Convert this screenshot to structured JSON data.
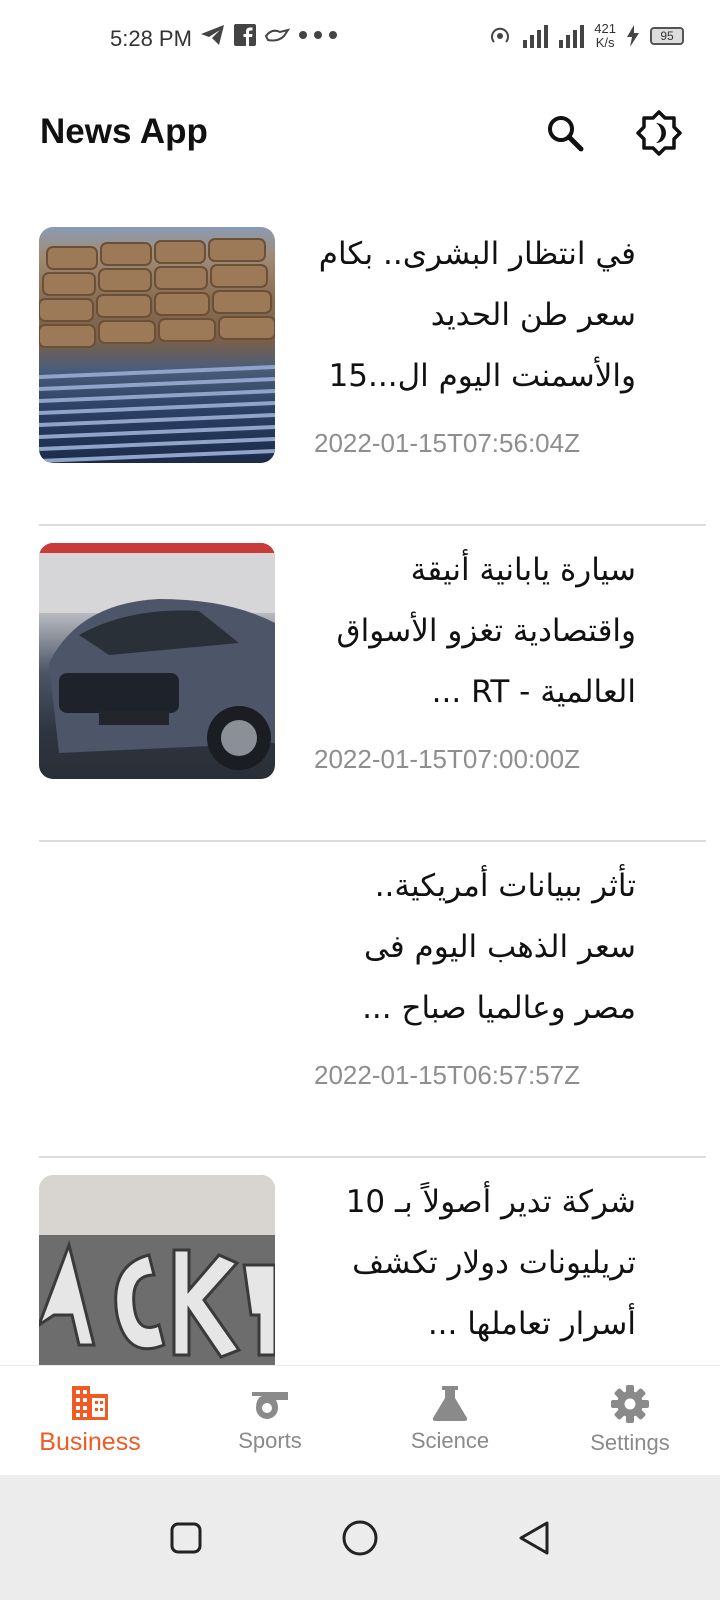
{
  "status_bar": {
    "time": "5:28 PM",
    "speed_value": "421",
    "speed_unit": "K/s",
    "battery": "95"
  },
  "app_bar": {
    "title": "News App",
    "icons": [
      "search-icon",
      "brightness-icon"
    ]
  },
  "articles": [
    {
      "title": "في انتظار البشرى.. بكام سعر طن الحديد والأسمنت اليوم ال...15",
      "date": "2022-01-15T07:56:04Z",
      "has_image": true
    },
    {
      "title": "سيارة يابانية أنيقة واقتصادية تغزو الأسواق العالمية - RT ...",
      "date": "2022-01-15T07:00:00Z",
      "has_image": true
    },
    {
      "title": "تأثر ببيانات أمريكية.. سعر الذهب اليوم فى مصر وعالميا صباح ...",
      "date": "2022-01-15T06:57:57Z",
      "has_image": false
    },
    {
      "title": "شركة تدير أصولاً بـ 10 تريليونات دولار تكشف أسرار تعاملها ...",
      "date": "",
      "has_image": true
    }
  ],
  "bottom_nav": {
    "items": [
      {
        "label": "Business",
        "icon": "business-icon",
        "active": true
      },
      {
        "label": "Sports",
        "icon": "whistle-icon",
        "active": false
      },
      {
        "label": "Science",
        "icon": "flask-icon",
        "active": false
      },
      {
        "label": "Settings",
        "icon": "gear-icon",
        "active": false
      }
    ]
  },
  "colors": {
    "accent": "#f05a24",
    "inactive": "#8a8a8a",
    "divider": "#dcdcdc",
    "date_text": "#8e8e8e"
  }
}
